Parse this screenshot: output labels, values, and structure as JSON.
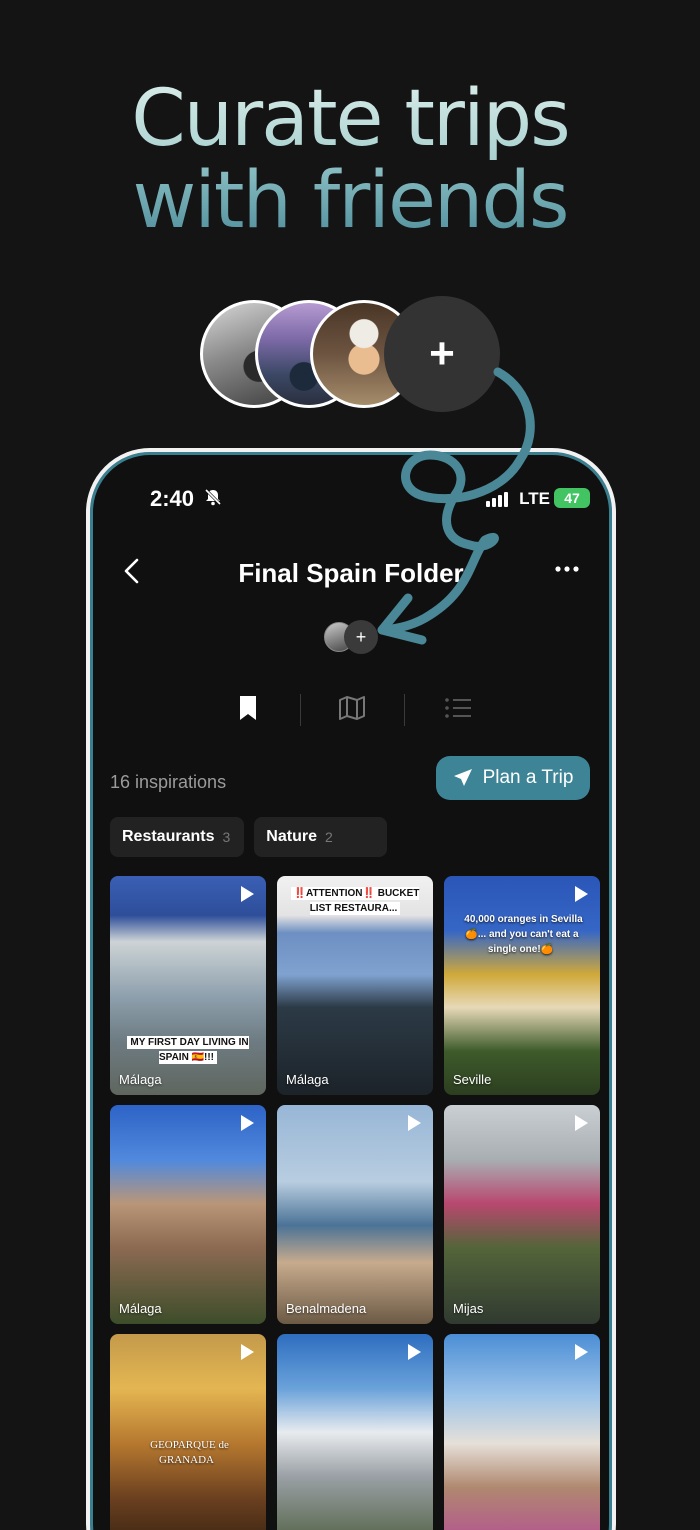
{
  "headline": {
    "line1": "Curate trips",
    "line2": "with friends"
  },
  "add_friend": {
    "icon": "plus-icon",
    "label": "+"
  },
  "status_bar": {
    "time": "2:40",
    "network": "LTE",
    "battery": "47"
  },
  "nav": {
    "back_icon": "chevron-left-icon",
    "title": "Final Spain Folder",
    "more_icon": "more-icon"
  },
  "members": {
    "add_label": "+"
  },
  "tabs": [
    {
      "icon": "bookmark-icon",
      "active": true
    },
    {
      "icon": "map-icon",
      "active": false
    },
    {
      "icon": "list-icon",
      "active": false
    }
  ],
  "inspirations": {
    "count_label": "16 inspirations"
  },
  "plan_button": {
    "label": "Plan a Trip",
    "icon": "send-icon"
  },
  "filters": [
    {
      "label": "Restaurants",
      "count": "3"
    },
    {
      "label": "Nature",
      "count": "2"
    }
  ],
  "cards": [
    {
      "location": "Málaga",
      "caption": "MY FIRST DAY LIVING IN SPAIN 🇪🇸!!!"
    },
    {
      "location": "Málaga",
      "caption": "‼️ATTENTION‼️ BUCKET LIST RESTAURA..."
    },
    {
      "location": "Seville",
      "caption": "40,000 oranges in Sevilla 🍊... and you can't eat a single one!🍊"
    },
    {
      "location": "Málaga",
      "caption": ""
    },
    {
      "location": "Benalmadena",
      "caption": ""
    },
    {
      "location": "Mijas",
      "caption": ""
    },
    {
      "location": "",
      "caption": "GEOPARQUE de GRANADA"
    },
    {
      "location": "",
      "caption": ""
    },
    {
      "location": "",
      "caption": ""
    }
  ],
  "colors": {
    "accent": "#3d8596",
    "background": "#141414",
    "arrow": "#4a8797"
  }
}
